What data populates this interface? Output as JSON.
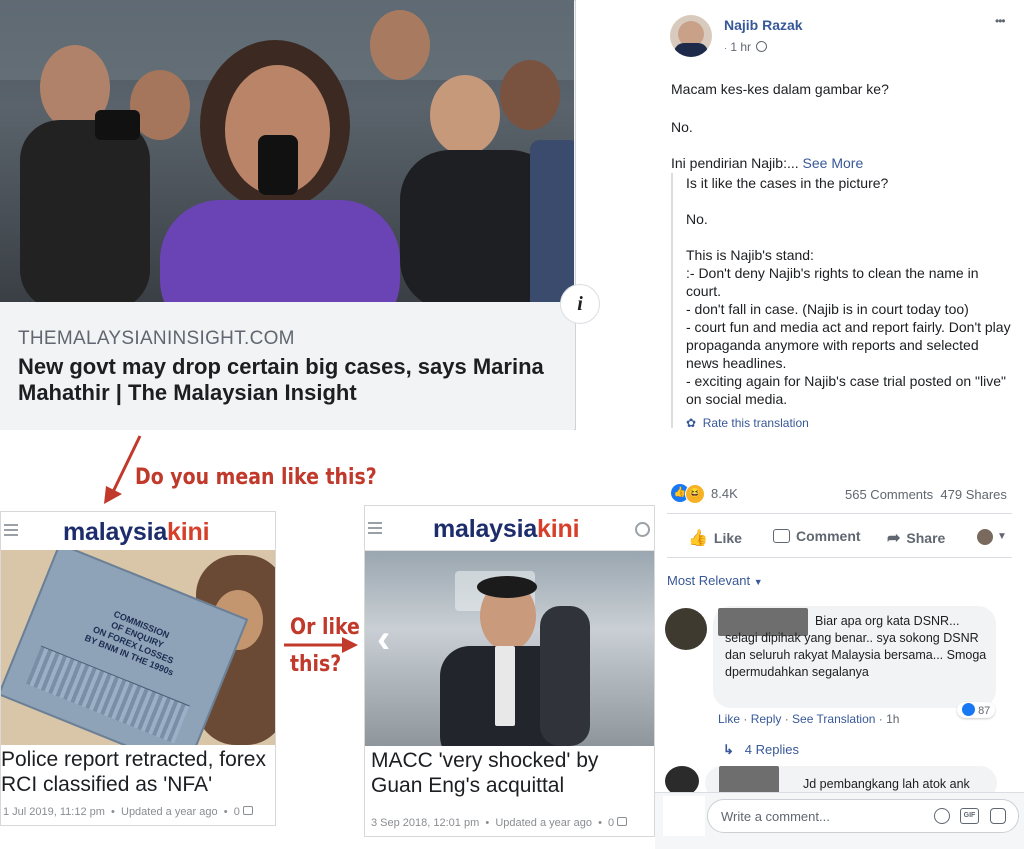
{
  "preview": {
    "domain": "THEMALAYSIANINSIGHT.COM",
    "headline": "New govt may drop certain big cases, says Marina Mahathir | The Malaysian Insight",
    "info_glyph": "i"
  },
  "annotations": {
    "question1": "Do you mean like this?",
    "question2_line1": "Or like",
    "question2_line2": "this?",
    "colors": {
      "annotation": "#c0392b"
    }
  },
  "cards": [
    {
      "logo_a": "malaysia",
      "logo_b": "kini",
      "cover_lines": [
        "COMMISSION",
        "OF ENQUIRY",
        "ON FOREX LOSSES",
        "BY BNM IN THE 1990s"
      ],
      "title": "Police report retracted, forex RCI classified as 'NFA'",
      "date": "1 Jul 2019, 11:12 pm",
      "updated": "Updated a year ago",
      "comments": "0"
    },
    {
      "logo_a": "malaysia",
      "logo_b": "kini",
      "title": "MACC 'very shocked' by Guan Eng's acquittal",
      "date": "3 Sep 2018, 12:01 pm",
      "updated": "Updated a year ago",
      "comments": "0",
      "nav_glyph": "‹"
    }
  ],
  "post": {
    "author": "Najib Razak",
    "time": "1 hr",
    "more_glyph": "•••",
    "lines": [
      "Macam kes-kes dalam gambar ke?",
      "No.",
      "Ini pendirian Najib:..."
    ],
    "see_more": "See More",
    "translation": [
      "Is it like the cases in the picture?",
      "No.",
      "This is Najib's stand:",
      ":- Don't deny Najib's rights to clean the name in court.",
      "- don't fall in case. (Najib is in court today too)",
      "- court fun and media act and report fairly. Don't play propaganda anymore with reports and selected news headlines.",
      "- exciting again for Najib's case trial posted on \"live\" on social media."
    ],
    "rate_translation": "Rate this translation",
    "reactions_count": "8.4K",
    "comments_count": "565 Comments",
    "shares_count": "479 Shares",
    "actions": {
      "like": "Like",
      "comment": "Comment",
      "share": "Share"
    },
    "sort_label": "Most Relevant",
    "comments": [
      {
        "text": "Biar apa org kata DSNR... selagi dipihak yang benar.. sya sokong DSNR dan seluruh rakyat Malaysia bersama... Smoga dpermudahkan segalanya",
        "like": "Like",
        "reply": "Reply",
        "see_translation": "See Translation",
        "time": "1h",
        "reactions": "87",
        "replies": "4 Replies"
      },
      {
        "text": "Jd pembangkang lah atok ank"
      }
    ],
    "composer_placeholder": "Write a comment...",
    "gif_label": "GIF",
    "colors": {
      "link": "#385898",
      "secondary": "#606770",
      "like_blue": "#1877f2"
    }
  }
}
